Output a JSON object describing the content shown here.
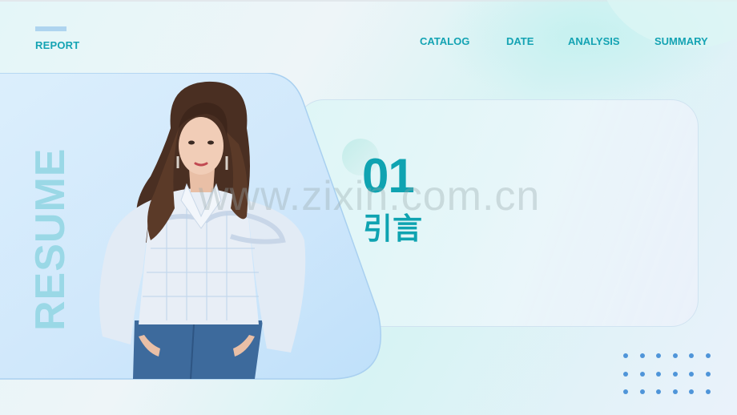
{
  "header": {
    "logo_label": "REPORT",
    "nav": [
      {
        "label": "CATALOG"
      },
      {
        "label": "DATE"
      },
      {
        "label": "ANALYSIS"
      },
      {
        "label": "SUMMARY"
      }
    ]
  },
  "sidebar": {
    "vertical_title": "RESUME"
  },
  "photo": {
    "description": "woman in white ruffled plaid blouse and blue jeans"
  },
  "section": {
    "number": "01",
    "title": "引言"
  },
  "watermark": "www.zixin.com.cn",
  "decoration": {
    "dot_grid_rows": 3,
    "dot_grid_cols": 6,
    "dot_color": "#4f95d9"
  },
  "colors": {
    "accent": "#0fa3b1",
    "resume_text": "#9ad8e6",
    "logo_bar": "#aed4ef",
    "panel_blue": "#cfe8fb"
  }
}
